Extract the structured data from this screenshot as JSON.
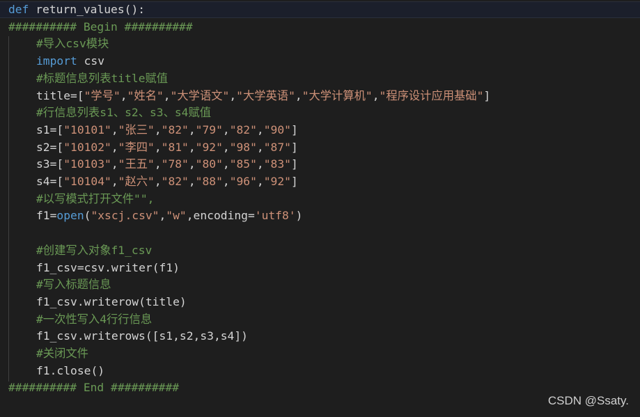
{
  "code": {
    "lines": [
      {
        "tokens": [
          {
            "t": "def",
            "c": "kw"
          },
          {
            "t": " ",
            "c": "pun"
          },
          {
            "t": "return_values",
            "c": "var"
          },
          {
            "t": "():",
            "c": "pun"
          }
        ]
      },
      {
        "tokens": [
          {
            "t": "########## Begin ##########",
            "c": "com"
          }
        ]
      },
      {
        "tokens": [
          {
            "t": "#导入csv模块",
            "c": "com"
          }
        ]
      },
      {
        "tokens": [
          {
            "t": "import",
            "c": "kw"
          },
          {
            "t": " csv",
            "c": "var"
          }
        ]
      },
      {
        "tokens": [
          {
            "t": "#标题信息列表title赋值",
            "c": "com"
          }
        ]
      },
      {
        "tokens": [
          {
            "t": "title",
            "c": "var"
          },
          {
            "t": "=[",
            "c": "pun"
          },
          {
            "t": "\"学号\"",
            "c": "str"
          },
          {
            "t": ",",
            "c": "pun"
          },
          {
            "t": "\"姓名\"",
            "c": "str"
          },
          {
            "t": ",",
            "c": "pun"
          },
          {
            "t": "\"大学语文\"",
            "c": "str"
          },
          {
            "t": ",",
            "c": "pun"
          },
          {
            "t": "\"大学英语\"",
            "c": "str"
          },
          {
            "t": ",",
            "c": "pun"
          },
          {
            "t": "\"大学计算机\"",
            "c": "str"
          },
          {
            "t": ",",
            "c": "pun"
          },
          {
            "t": "\"程序设计应用基础\"",
            "c": "str"
          },
          {
            "t": "]",
            "c": "pun"
          }
        ]
      },
      {
        "tokens": [
          {
            "t": "#行信息列表s1、s2、s3、s4赋值",
            "c": "com"
          }
        ]
      },
      {
        "tokens": [
          {
            "t": "s1",
            "c": "var"
          },
          {
            "t": "=[",
            "c": "pun"
          },
          {
            "t": "\"10101\"",
            "c": "str"
          },
          {
            "t": ",",
            "c": "pun"
          },
          {
            "t": "\"张三\"",
            "c": "str"
          },
          {
            "t": ",",
            "c": "pun"
          },
          {
            "t": "\"82\"",
            "c": "str"
          },
          {
            "t": ",",
            "c": "pun"
          },
          {
            "t": "\"79\"",
            "c": "str"
          },
          {
            "t": ",",
            "c": "pun"
          },
          {
            "t": "\"82\"",
            "c": "str"
          },
          {
            "t": ",",
            "c": "pun"
          },
          {
            "t": "\"90\"",
            "c": "str"
          },
          {
            "t": "]",
            "c": "pun"
          }
        ]
      },
      {
        "tokens": [
          {
            "t": "s2",
            "c": "var"
          },
          {
            "t": "=[",
            "c": "pun"
          },
          {
            "t": "\"10102\"",
            "c": "str"
          },
          {
            "t": ",",
            "c": "pun"
          },
          {
            "t": "\"李四\"",
            "c": "str"
          },
          {
            "t": ",",
            "c": "pun"
          },
          {
            "t": "\"81\"",
            "c": "str"
          },
          {
            "t": ",",
            "c": "pun"
          },
          {
            "t": "\"92\"",
            "c": "str"
          },
          {
            "t": ",",
            "c": "pun"
          },
          {
            "t": "\"98\"",
            "c": "str"
          },
          {
            "t": ",",
            "c": "pun"
          },
          {
            "t": "\"87\"",
            "c": "str"
          },
          {
            "t": "]",
            "c": "pun"
          }
        ]
      },
      {
        "tokens": [
          {
            "t": "s3",
            "c": "var"
          },
          {
            "t": "=[",
            "c": "pun"
          },
          {
            "t": "\"10103\"",
            "c": "str"
          },
          {
            "t": ",",
            "c": "pun"
          },
          {
            "t": "\"王五\"",
            "c": "str"
          },
          {
            "t": ",",
            "c": "pun"
          },
          {
            "t": "\"78\"",
            "c": "str"
          },
          {
            "t": ",",
            "c": "pun"
          },
          {
            "t": "\"80\"",
            "c": "str"
          },
          {
            "t": ",",
            "c": "pun"
          },
          {
            "t": "\"85\"",
            "c": "str"
          },
          {
            "t": ",",
            "c": "pun"
          },
          {
            "t": "\"83\"",
            "c": "str"
          },
          {
            "t": "]",
            "c": "pun"
          }
        ]
      },
      {
        "tokens": [
          {
            "t": "s4",
            "c": "var"
          },
          {
            "t": "=[",
            "c": "pun"
          },
          {
            "t": "\"10104\"",
            "c": "str"
          },
          {
            "t": ",",
            "c": "pun"
          },
          {
            "t": "\"赵六\"",
            "c": "str"
          },
          {
            "t": ",",
            "c": "pun"
          },
          {
            "t": "\"82\"",
            "c": "str"
          },
          {
            "t": ",",
            "c": "pun"
          },
          {
            "t": "\"88\"",
            "c": "str"
          },
          {
            "t": ",",
            "c": "pun"
          },
          {
            "t": "\"96\"",
            "c": "str"
          },
          {
            "t": ",",
            "c": "pun"
          },
          {
            "t": "\"92\"",
            "c": "str"
          },
          {
            "t": "]",
            "c": "pun"
          }
        ]
      },
      {
        "tokens": [
          {
            "t": "#以写模式打开文件\"\",",
            "c": "com"
          }
        ]
      },
      {
        "tokens": [
          {
            "t": "f1",
            "c": "var"
          },
          {
            "t": "=",
            "c": "pun"
          },
          {
            "t": "open",
            "c": "kw"
          },
          {
            "t": "(",
            "c": "pun"
          },
          {
            "t": "\"xscj.csv\"",
            "c": "str"
          },
          {
            "t": ",",
            "c": "pun"
          },
          {
            "t": "\"w\"",
            "c": "str"
          },
          {
            "t": ",",
            "c": "pun"
          },
          {
            "t": "encoding",
            "c": "var"
          },
          {
            "t": "=",
            "c": "pun"
          },
          {
            "t": "'utf8'",
            "c": "str"
          },
          {
            "t": ")",
            "c": "pun"
          }
        ]
      },
      {
        "tokens": []
      },
      {
        "tokens": [
          {
            "t": "#创建写入对象f1_csv",
            "c": "com"
          }
        ]
      },
      {
        "tokens": [
          {
            "t": "f1_csv",
            "c": "var"
          },
          {
            "t": "=",
            "c": "pun"
          },
          {
            "t": "csv",
            "c": "var"
          },
          {
            "t": ".",
            "c": "pun"
          },
          {
            "t": "writer",
            "c": "var"
          },
          {
            "t": "(",
            "c": "pun"
          },
          {
            "t": "f1",
            "c": "var"
          },
          {
            "t": ")",
            "c": "pun"
          }
        ]
      },
      {
        "tokens": [
          {
            "t": "#写入标题信息",
            "c": "com"
          }
        ]
      },
      {
        "tokens": [
          {
            "t": "f1_csv",
            "c": "var"
          },
          {
            "t": ".",
            "c": "pun"
          },
          {
            "t": "writerow",
            "c": "var"
          },
          {
            "t": "(",
            "c": "pun"
          },
          {
            "t": "title",
            "c": "var"
          },
          {
            "t": ")",
            "c": "pun"
          }
        ]
      },
      {
        "tokens": [
          {
            "t": "#一次性写入4行行信息",
            "c": "com"
          }
        ]
      },
      {
        "tokens": [
          {
            "t": "f1_csv",
            "c": "var"
          },
          {
            "t": ".",
            "c": "pun"
          },
          {
            "t": "writerows",
            "c": "var"
          },
          {
            "t": "([",
            "c": "pun"
          },
          {
            "t": "s1",
            "c": "var"
          },
          {
            "t": ",",
            "c": "pun"
          },
          {
            "t": "s2",
            "c": "var"
          },
          {
            "t": ",",
            "c": "pun"
          },
          {
            "t": "s3",
            "c": "var"
          },
          {
            "t": ",",
            "c": "pun"
          },
          {
            "t": "s4",
            "c": "var"
          },
          {
            "t": "])",
            "c": "pun"
          }
        ]
      },
      {
        "tokens": [
          {
            "t": "#关闭文件",
            "c": "com"
          }
        ]
      },
      {
        "tokens": [
          {
            "t": "f1",
            "c": "var"
          },
          {
            "t": ".",
            "c": "pun"
          },
          {
            "t": "close",
            "c": "var"
          },
          {
            "t": "()",
            "c": "pun"
          }
        ]
      },
      {
        "tokens": [
          {
            "t": "########## End ##########",
            "c": "com"
          }
        ]
      }
    ]
  },
  "watermark": {
    "text": "CSDN @Ssaty."
  },
  "colors": {
    "background": "#1e1e1e",
    "keyword": "#569cd6",
    "string": "#ce9178",
    "comment": "#6a9955",
    "default": "#d4d4d4"
  }
}
